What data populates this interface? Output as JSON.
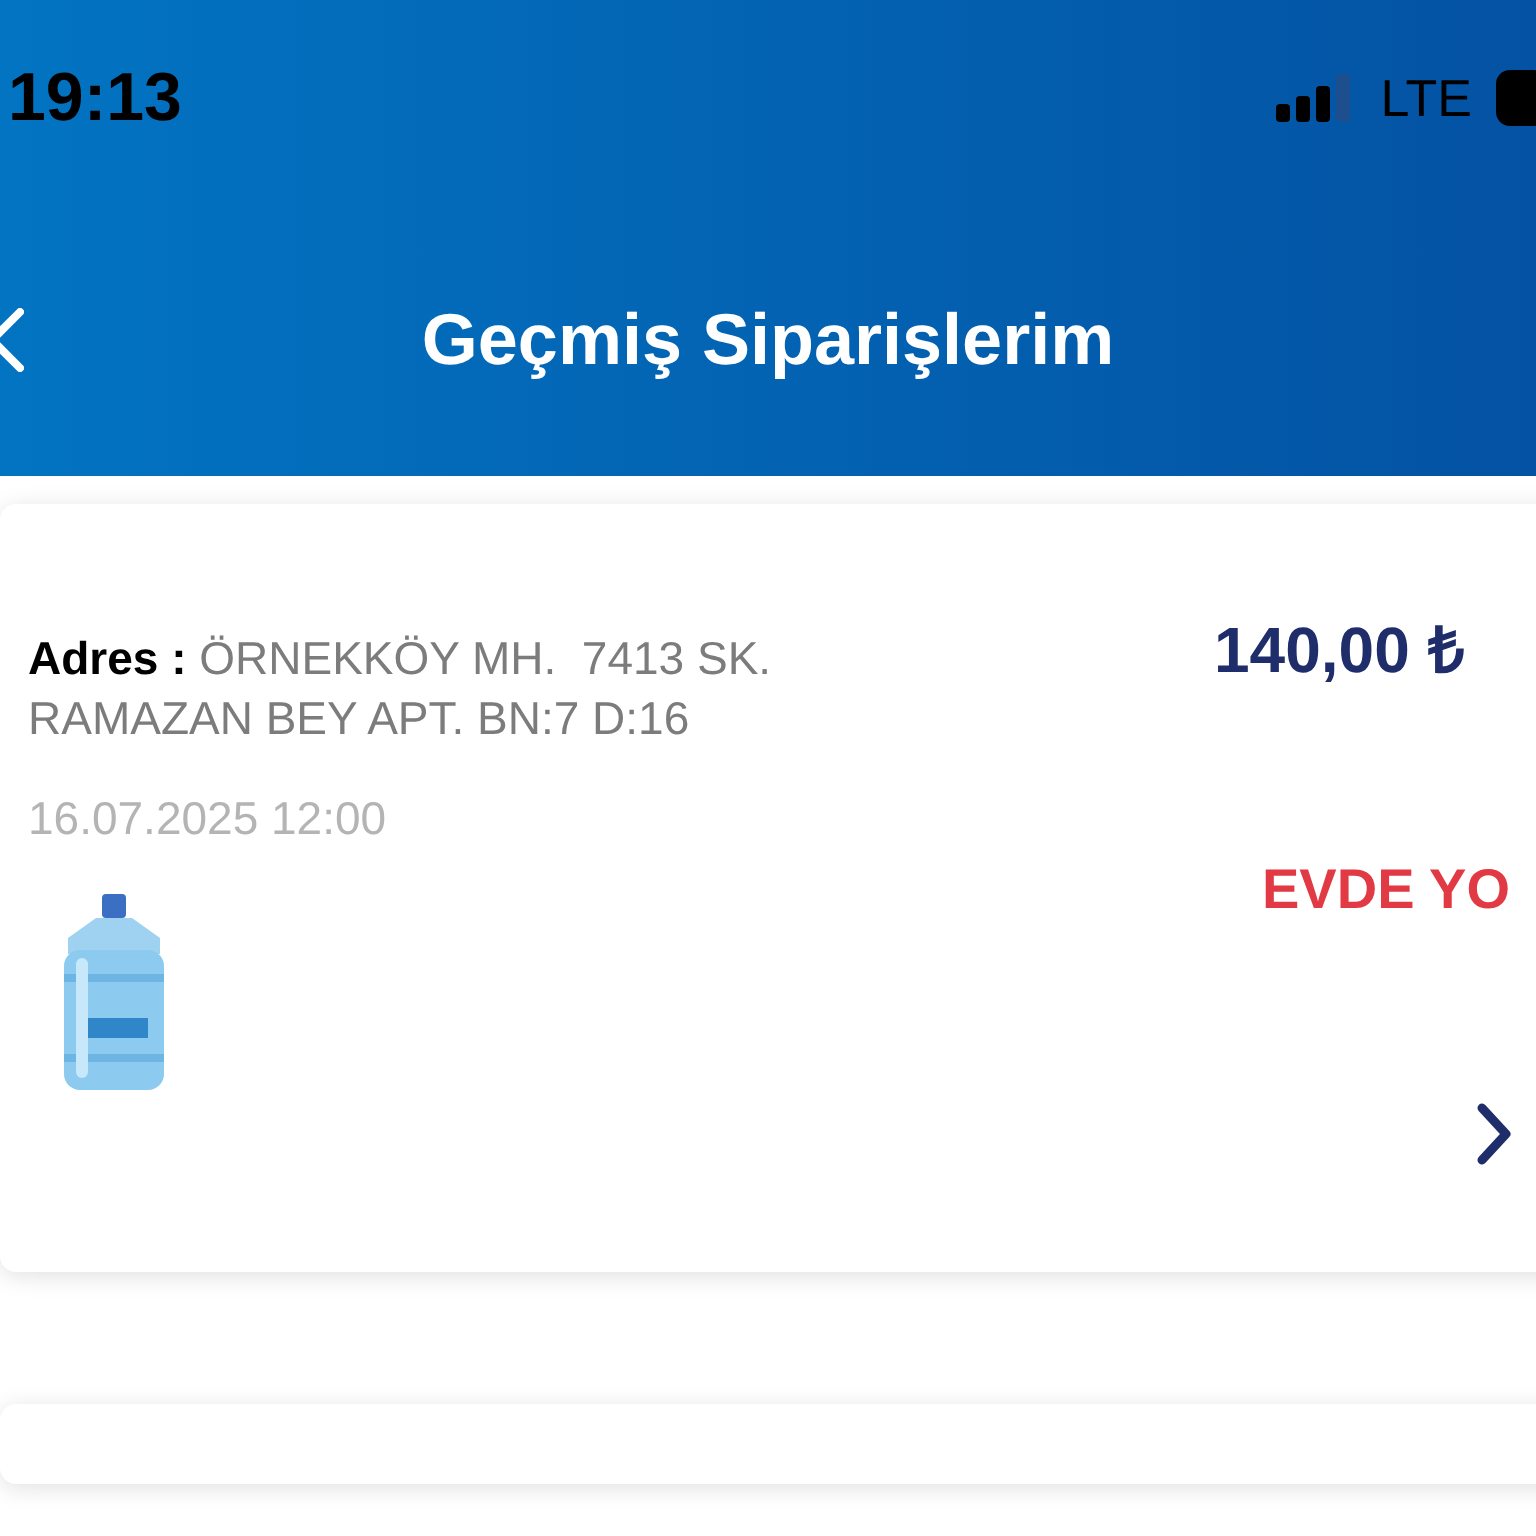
{
  "status_bar": {
    "time": "19:13",
    "network": "LTE"
  },
  "header": {
    "title": "Geçmiş Siparişlerim"
  },
  "orders": [
    {
      "address_label": "Adres :",
      "address": "ÖRNEKKÖY MH.  7413 SK. RAMAZAN BEY APT. BN:7 D:16",
      "date": "16.07.2025 12:00",
      "price": "140,00 ₺",
      "status": "EVDE YO",
      "color": "#e23a44"
    }
  ]
}
